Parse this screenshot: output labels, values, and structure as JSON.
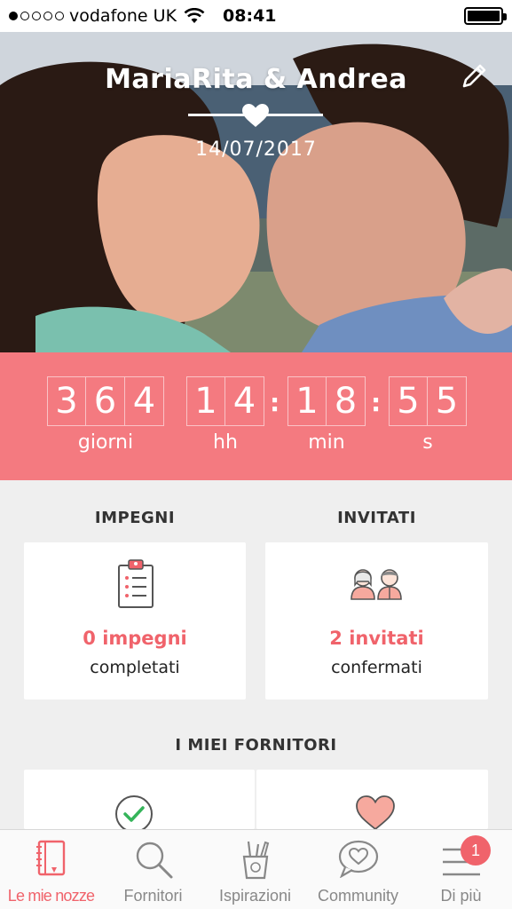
{
  "status_bar": {
    "carrier": "vodafone UK",
    "time": "08:41"
  },
  "hero": {
    "couple_names": "MariaRita & Andrea",
    "wedding_date": "14/07/2017"
  },
  "countdown": {
    "days": [
      "3",
      "6",
      "4"
    ],
    "hours": [
      "1",
      "4"
    ],
    "minutes": [
      "1",
      "8"
    ],
    "seconds": [
      "5",
      "5"
    ],
    "separator": ":",
    "labels": {
      "days": "giorni",
      "hours": "hh",
      "minutes": "min",
      "seconds": "s"
    }
  },
  "impegni": {
    "title": "IMPEGNI",
    "count_text": "0 impegni",
    "status_text": "completati"
  },
  "invitati": {
    "title": "INVITATI",
    "count_text": "2 invitati",
    "status_text": "confermati"
  },
  "fornitori": {
    "title": "I MIEI FORNITORI"
  },
  "tab_bar": {
    "tabs": [
      {
        "label": "Le mie nozze",
        "icon": "notebook-icon",
        "active": true
      },
      {
        "label": "Fornitori",
        "icon": "search-icon",
        "active": false
      },
      {
        "label": "Ispirazioni",
        "icon": "pencil-cup-icon",
        "active": false
      },
      {
        "label": "Community",
        "icon": "heart-chat-icon",
        "active": false
      },
      {
        "label": "Di più",
        "icon": "menu-icon",
        "active": false
      }
    ],
    "badge_count": "1"
  },
  "colors": {
    "accent": "#f47a80",
    "accent_text": "#f0636b",
    "background": "#efefef"
  }
}
